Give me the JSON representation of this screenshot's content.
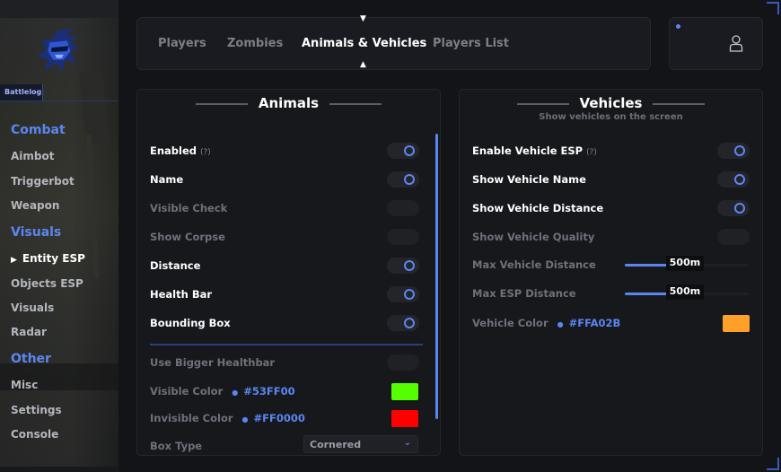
{
  "sidebar": {
    "brand": "Battlelog",
    "groups": [
      {
        "label": "Combat",
        "items": [
          "Aimbot",
          "Triggerbot",
          "Weapon"
        ]
      },
      {
        "label": "Visuals",
        "items": [
          "Entity ESP",
          "Objects ESP",
          "Visuals",
          "Radar"
        ]
      },
      {
        "label": "Other",
        "items": [
          "Misc",
          "Settings",
          "Console"
        ]
      }
    ],
    "active_item": "Entity ESP"
  },
  "tabs": [
    {
      "label": "Players"
    },
    {
      "label": "Zombies"
    },
    {
      "label": "Animals & Vehicles"
    },
    {
      "label": "Players List"
    }
  ],
  "active_tab": "Animals & Vehicles",
  "icons": {
    "user": "user-icon",
    "logo": "knight-helmet-logo",
    "arrow": "triangle-right-icon"
  },
  "accent_color": "#5B86F0",
  "animals": {
    "title": "Animals",
    "rows": {
      "enabled": {
        "label": "Enabled",
        "help": "(?)",
        "on": true
      },
      "name": {
        "label": "Name",
        "on": true
      },
      "visible_check": {
        "label": "Visible Check",
        "on": false
      },
      "show_corpse": {
        "label": "Show Corpse",
        "on": false
      },
      "distance": {
        "label": "Distance",
        "on": true
      },
      "health_bar": {
        "label": "Health Bar",
        "on": true
      },
      "bounding_box": {
        "label": "Bounding Box",
        "on": true
      },
      "bigger_healthbar": {
        "label": "Use Bigger Healthbar",
        "on": false
      }
    },
    "visible_color": {
      "label": "Visible Color",
      "hex": "#53FF00"
    },
    "invisible_color": {
      "label": "Invisible Color",
      "hex": "#FF0000"
    },
    "box_type": {
      "label": "Box Type",
      "value": "Cornered"
    }
  },
  "vehicles": {
    "title": "Vehicles",
    "subtitle": "Show vehicles on the screen",
    "rows": {
      "enable_esp": {
        "label": "Enable Vehicle ESP",
        "help": "(?)",
        "on": true
      },
      "show_name": {
        "label": "Show Vehicle Name",
        "on": true
      },
      "show_distance": {
        "label": "Show Vehicle Distance",
        "on": true
      },
      "show_quality": {
        "label": "Show Vehicle Quality",
        "on": false
      }
    },
    "max_vehicle_distance": {
      "label": "Max Vehicle Distance",
      "value": "500m",
      "fraction": 0.48
    },
    "max_esp_distance": {
      "label": "Max ESP Distance",
      "value": "500m",
      "fraction": 0.48
    },
    "vehicle_color": {
      "label": "Vehicle Color",
      "hex": "#FFA02B"
    }
  }
}
